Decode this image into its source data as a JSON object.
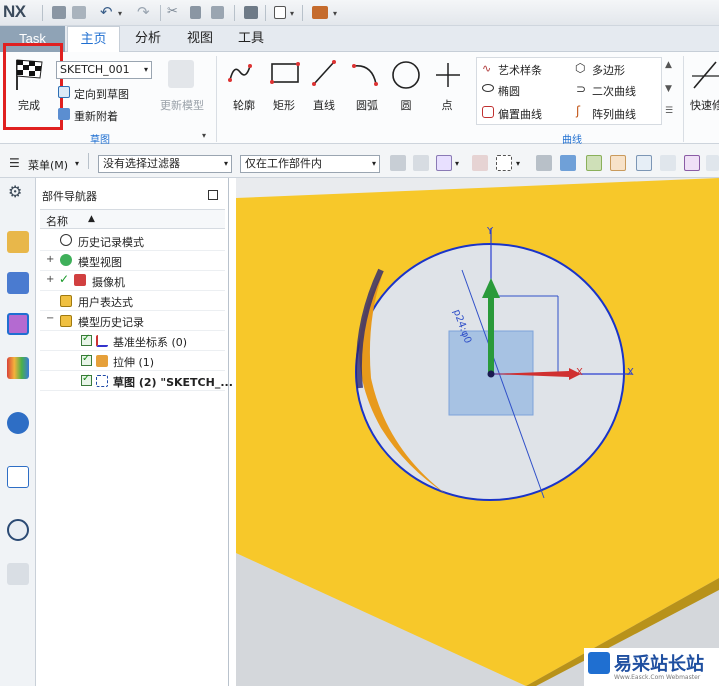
{
  "app": {
    "logo": "NX"
  },
  "tabs": {
    "task": "Task",
    "home": "主页",
    "analysis": "分析",
    "view": "视图",
    "tools": "工具"
  },
  "ribbon": {
    "finish_label": "完成",
    "sketch_name": "SKETCH_001",
    "orient_label": "定向到草图",
    "reattach_label": "重新附着",
    "update_model_label": "更新模型",
    "group_sketch": "草图",
    "tools": {
      "profile": "轮廓",
      "rectangle": "矩形",
      "line": "直线",
      "arc": "圆弧",
      "circle": "圆",
      "point": "点"
    },
    "curve": {
      "art_spline": "艺术样条",
      "polygon": "多边形",
      "ellipse": "椭圆",
      "conic": "二次曲线",
      "offset": "偏置曲线",
      "pattern": "阵列曲线",
      "quick_trim": "快速修"
    },
    "group_curve": "曲线"
  },
  "toolbar2": {
    "menu_label": "菜单(M)",
    "filter_value": "没有选择过滤器",
    "scope_value": "仅在工作部件内"
  },
  "navigator": {
    "title": "部件导航器",
    "column_name": "名称",
    "items": [
      {
        "label": "历史记录模式"
      },
      {
        "label": "模型视图"
      },
      {
        "label": "摄像机"
      },
      {
        "label": "用户表达式"
      },
      {
        "label": "模型历史记录"
      },
      {
        "label": "基准坐标系 (0)"
      },
      {
        "label": "拉伸 (1)"
      },
      {
        "label": "草图 (2) \"SKETCH_..."
      }
    ]
  },
  "viewport": {
    "dimension_label": "p24:φ0",
    "axis_x": "X",
    "axis_y": "Y",
    "watermark": "易采站长站",
    "watermark_sub": "Www.Easck.Com  Webmaster",
    "colors": {
      "plate": "#f7c82a",
      "hole": "#dfe3e8",
      "sketch": "#1a34c8",
      "accent": "#1f6fd1"
    }
  }
}
